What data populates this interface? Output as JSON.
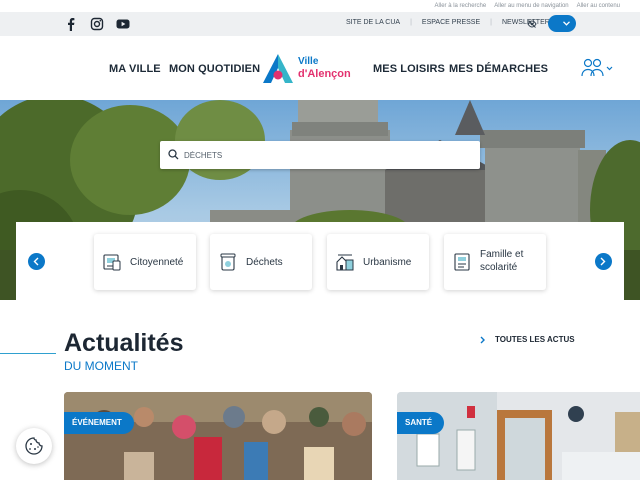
{
  "skip_links": [
    "Aller à la recherche",
    "Aller au menu de navigation",
    "Aller au contenu"
  ],
  "social": [
    "facebook-icon",
    "instagram-icon",
    "youtube-icon"
  ],
  "top_links": [
    "SITE DE LA CUA",
    "ESPACE PRESSE",
    "NEWSLETTER"
  ],
  "colors": {
    "accent": "#0b78c8",
    "brand_pink": "#e3326f",
    "topbar_bg": "#eef0f2"
  },
  "nav": {
    "left": [
      "MA VILLE",
      "MON QUOTIDIEN"
    ],
    "right": [
      "MES LOISIRS",
      "MES DÉMARCHES"
    ]
  },
  "logo": {
    "line1": "Ville",
    "line2": "d'Alençon"
  },
  "search": {
    "placeholder": "DÉCHETS"
  },
  "quick_links": [
    {
      "label": "Citoyenneté",
      "icon": "citizenship-icon"
    },
    {
      "label": "Déchets",
      "icon": "waste-bin-icon"
    },
    {
      "label": "Urbanisme",
      "icon": "urban-planning-icon"
    },
    {
      "label_line1": "Famille et",
      "label_line2": "scolarité",
      "icon": "family-school-icon"
    }
  ],
  "news_section": {
    "title": "Actualités",
    "subtitle": "DU MOMENT",
    "all_link": "TOUTES LES ACTUS",
    "cards": [
      {
        "tag": "ÉVÉNEMENT"
      },
      {
        "tag": "SANTÉ"
      }
    ]
  }
}
